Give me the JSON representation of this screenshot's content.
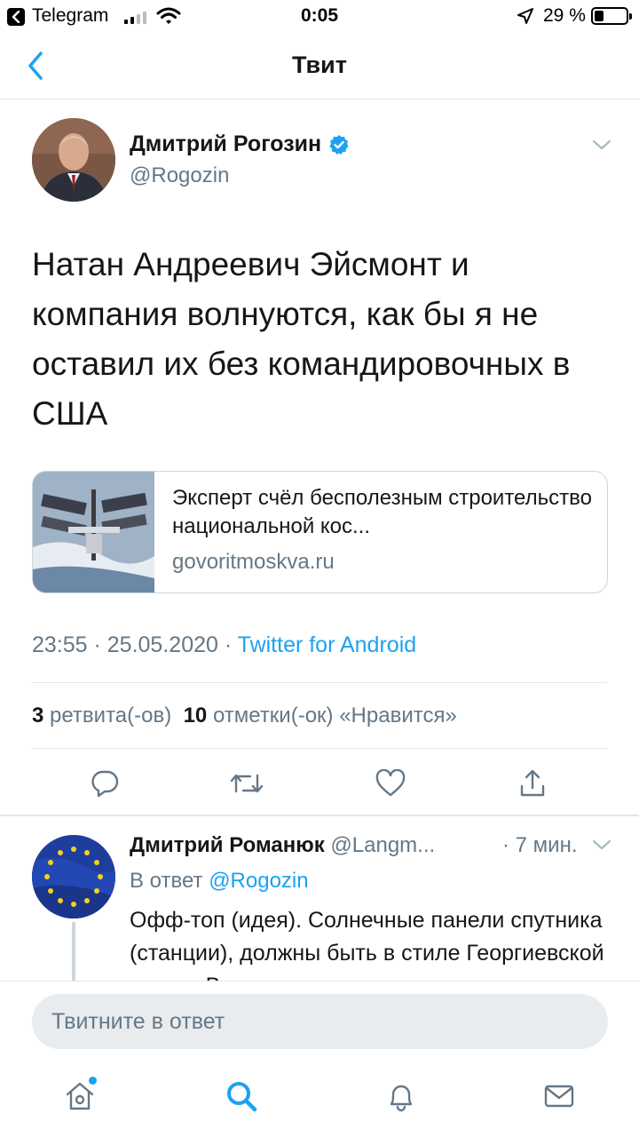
{
  "status_bar": {
    "app_name": "Telegram",
    "time": "0:05",
    "battery_text": "29 %",
    "battery_level": 0.29,
    "signal_bars": 2
  },
  "nav": {
    "title": "Твит"
  },
  "tweet": {
    "author_name": "Дмитрий Рогозин",
    "author_handle": "@Rogozin",
    "text": "Натан Андреевич Эйсмонт и компания волнуются, как бы я не оставил их без командировочных в США",
    "card": {
      "title": "Эксперт счёл бесполезным строительство национальной кос...",
      "domain": "govoritmoskva.ru"
    },
    "timestamp": "23:55 · 25.05.2020 · ",
    "source": "Twitter for Android",
    "retweet_count": "3",
    "retweet_label": "ретвита(-ов)",
    "like_count": "10",
    "like_label": "отметки(-ок) «Нравится»"
  },
  "reply": {
    "author_name": "Дмитрий Романюк",
    "author_handle": "@Langm...",
    "time": "· 7 мин.",
    "reply_to_prefix": "В ответ ",
    "reply_to_mention": "@Rogozin",
    "text": "Офф-топ (идея). Солнечные панели спутника (станции), должны быть в стиле Георгиевской ленты. Вы..."
  },
  "compose": {
    "placeholder": "Твитните в ответ"
  },
  "colors": {
    "accent": "#1da1f2",
    "secondary_text": "#657786",
    "divider": "#e1e8ed"
  },
  "icons": {
    "status": [
      "back-to-app-icon",
      "signal-icon",
      "wifi-icon",
      "location-arrow-icon",
      "battery-icon"
    ],
    "nav": [
      "back-chevron-icon"
    ],
    "actions": [
      "reply-icon",
      "retweet-icon",
      "like-icon",
      "share-icon"
    ],
    "tabs": [
      "home-icon",
      "search-icon",
      "notifications-icon",
      "messages-icon"
    ]
  }
}
